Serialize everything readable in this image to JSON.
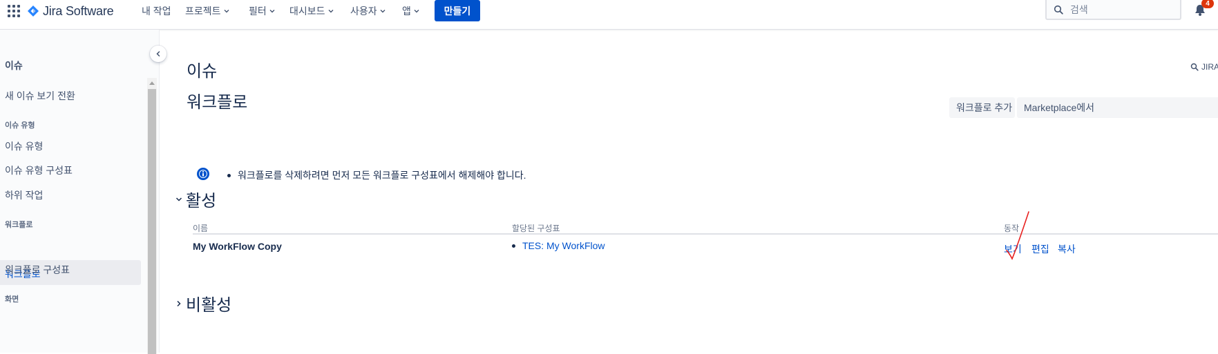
{
  "topnav": {
    "logo_text": "Jira Software",
    "items": [
      {
        "label": "내 작업",
        "dropdown": false
      },
      {
        "label": "프로젝트",
        "dropdown": true
      },
      {
        "label": "필터",
        "dropdown": true
      },
      {
        "label": "대시보드",
        "dropdown": true
      },
      {
        "label": "사용자",
        "dropdown": true
      },
      {
        "label": "앱",
        "dropdown": true
      }
    ],
    "create_label": "만들기",
    "search_placeholder": "검색",
    "notification_count": "4",
    "brand_color": "#0052cc",
    "badge_color": "#de350b"
  },
  "sidebar": {
    "heading": "이슈",
    "toggle_new_view": "새 이슈 보기 전환",
    "sections": [
      {
        "title": "이슈 유형",
        "items": [
          "이슈 유형",
          "이슈 유형 구성표",
          "하위 작업"
        ]
      },
      {
        "title": "워크플로",
        "items": [
          "워크플로",
          "워크플로 구성표"
        ]
      },
      {
        "title": "화면",
        "items": []
      }
    ],
    "active_item": "워크플로"
  },
  "main": {
    "page_title": "이슈",
    "section_title": "워크플로",
    "jira_search_label": "JIRA",
    "add_workflow_button": "워크플로 추가",
    "marketplace_button": "Marketplace에서",
    "info_message": "워크플로를 삭제하려면 먼저 모든 워크플로 구성표에서 해제해야 합니다.",
    "active_section": {
      "title": "활성",
      "expanded": true,
      "columns": [
        "이름",
        "할당된 구성표",
        "동작"
      ],
      "rows": [
        {
          "name": "My WorkFlow Copy",
          "scheme": "TES: My WorkFlow",
          "operations": [
            "보기",
            "편집",
            "복사"
          ]
        }
      ]
    },
    "inactive_section": {
      "title": "비활성",
      "expanded": false
    }
  },
  "icons": {
    "app_switcher": "grid-icon",
    "logo": "jira-diamond-icon",
    "search": "search-icon",
    "notifications": "bell-icon",
    "collapse": "chevron-left-icon",
    "info": "info-icon",
    "annotation": "red-checkmark-annotation"
  }
}
